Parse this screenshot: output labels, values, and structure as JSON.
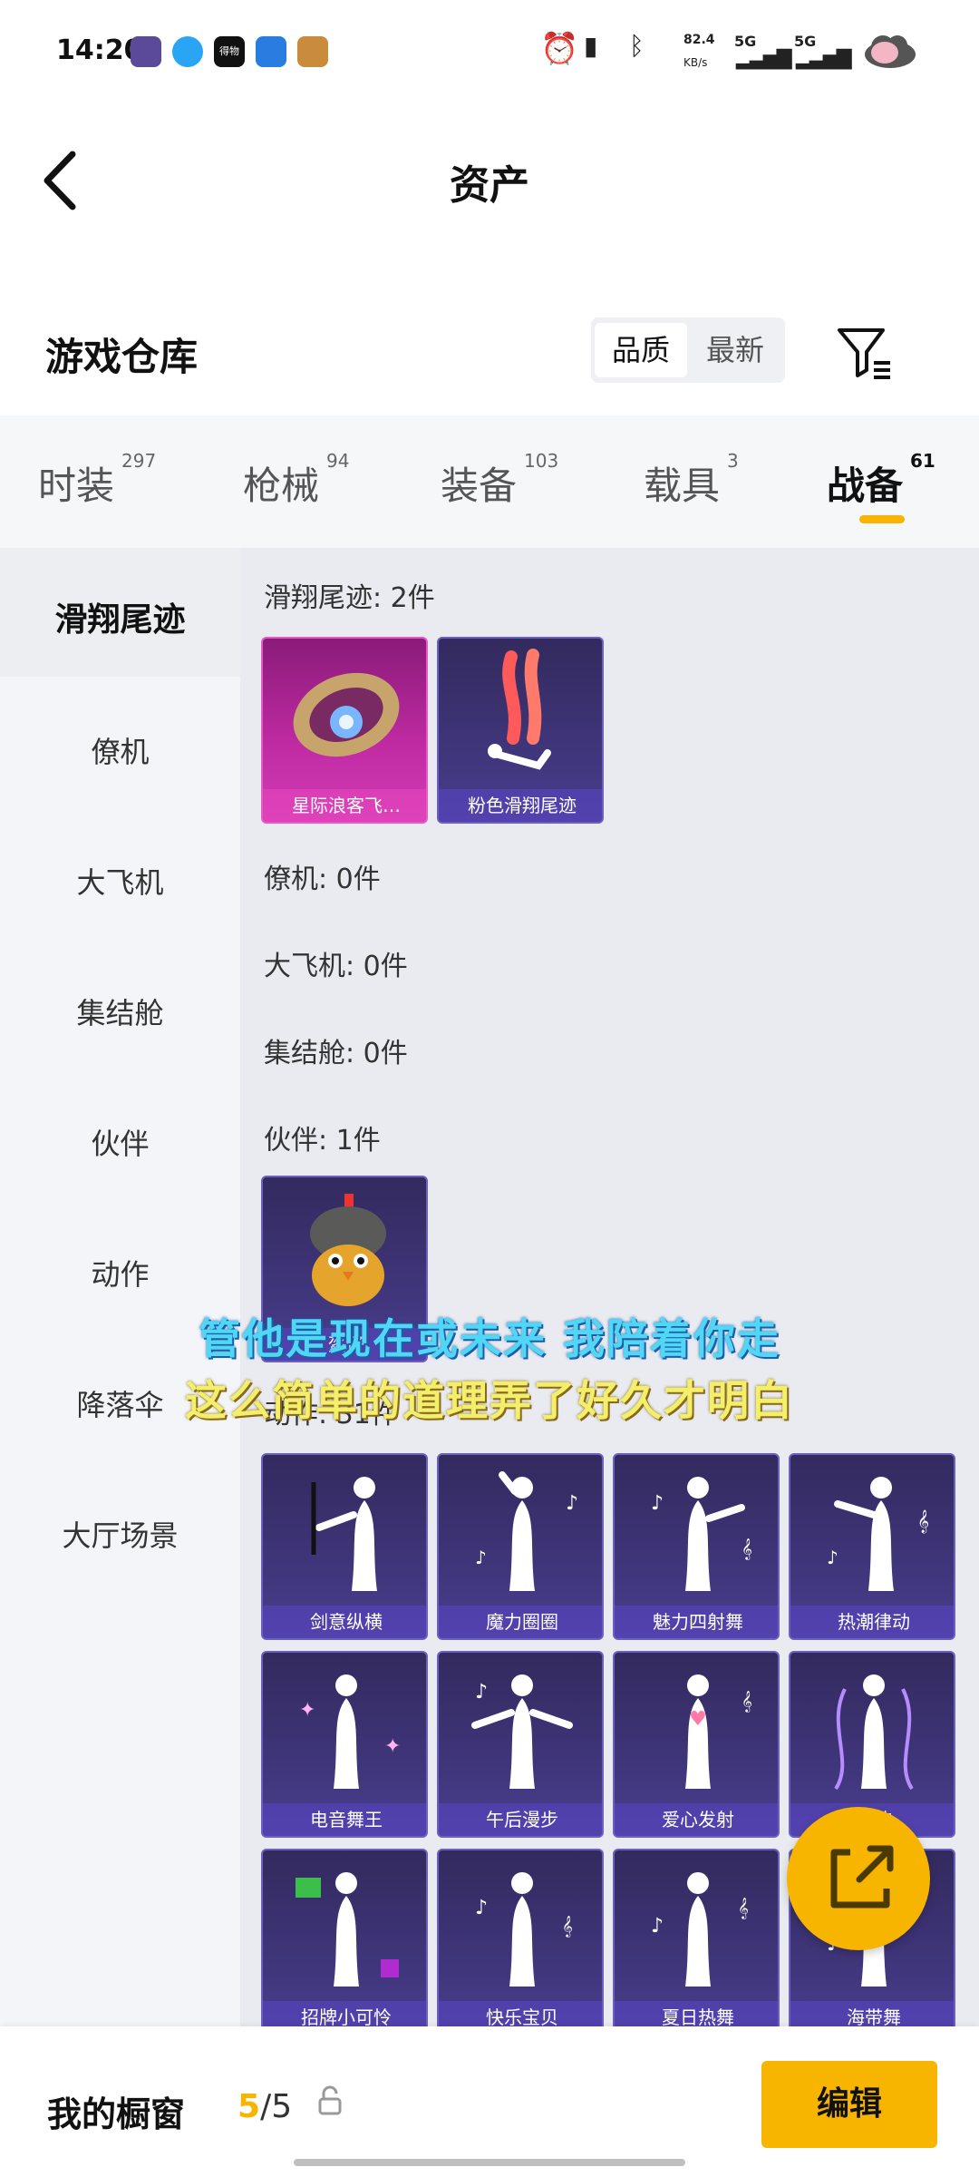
{
  "status_bar": {
    "time": "14:20",
    "net_speed_value": "82.4",
    "net_speed_unit": "KB/s",
    "signal1": "5G",
    "signal2": "5G",
    "app_icon_label": "得物"
  },
  "header": {
    "title": "资产"
  },
  "warehouse": {
    "title": "游戏仓库",
    "sort_quality": "品质",
    "sort_newest": "最新"
  },
  "tabs": [
    {
      "label": "时装",
      "count": "297"
    },
    {
      "label": "枪械",
      "count": "94"
    },
    {
      "label": "装备",
      "count": "103"
    },
    {
      "label": "载具",
      "count": "3"
    },
    {
      "label": "战备",
      "count": "61"
    }
  ],
  "sidebar": {
    "items": [
      "滑翔尾迹",
      "僚机",
      "大飞机",
      "集结舱",
      "伙伴",
      "动作",
      "降落伞",
      "大厅场景"
    ]
  },
  "sections": {
    "glide_trail": {
      "heading": "滑翔尾迹: 2件",
      "items": [
        "星际浪客飞…",
        "粉色滑翔尾迹"
      ]
    },
    "wingman": {
      "heading": "僚机: 0件"
    },
    "big_plane": {
      "heading": "大飞机: 0件"
    },
    "assembly_pod": {
      "heading": "集结舱: 0件"
    },
    "partner": {
      "heading": "伙伴: 1件",
      "items": [
        "盔仔"
      ]
    },
    "action": {
      "heading": "动作: 31件",
      "items": [
        "剑意纵横",
        "魔力圈圈",
        "魅力四射舞",
        "热潮律动",
        "电音舞王",
        "午后漫步",
        "爱心发射",
        "…波",
        "招牌小可怜",
        "快乐宝贝",
        "夏日热舞",
        "海带舞"
      ]
    }
  },
  "lyrics": {
    "line1": "管他是现在或未来 我陪着你走",
    "line2": "这么简单的道理弄了好久才明白"
  },
  "bottom_bar": {
    "showcase_label": "我的橱窗",
    "count_current": "5",
    "count_sep_total": "/5",
    "edit_label": "编辑"
  },
  "colors": {
    "accent": "#f7b500",
    "card_purple": "#3f357a",
    "card_pink": "#c12ba3",
    "lyric_cyan": "#4fd7f5",
    "lyric_yellow": "#f3ef6a"
  }
}
